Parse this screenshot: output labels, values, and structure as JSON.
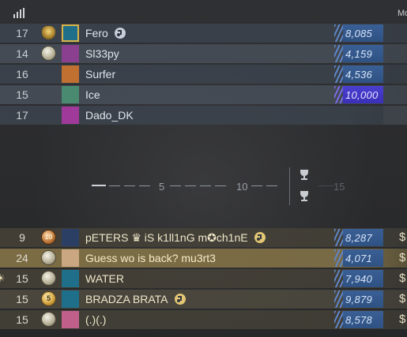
{
  "header": {
    "signal_icon": "signal-bars-icon",
    "col_label": "Mo"
  },
  "ct_players": [
    {
      "level": "17",
      "rank_icon": "crest",
      "avatar_color": "#1f6f8a",
      "avatar_frame": "gold",
      "name": "Fero",
      "music": true,
      "elo": "8,085",
      "elo_style": "blue"
    },
    {
      "level": "14",
      "rank_icon": "silver",
      "avatar_color": "#8a3f8f",
      "avatar_frame": "none",
      "name": "Sl33py",
      "music": false,
      "elo": "4,159",
      "elo_style": "blue"
    },
    {
      "level": "16",
      "rank_icon": "none",
      "avatar_color": "#c07030",
      "avatar_frame": "none",
      "name": "Surfer",
      "music": false,
      "elo": "4,536",
      "elo_style": "blue"
    },
    {
      "level": "15",
      "rank_icon": "none",
      "avatar_color": "#4a8a70",
      "avatar_frame": "none",
      "name": "Ice",
      "music": false,
      "elo": "10,000",
      "elo_style": "purple"
    },
    {
      "level": "17",
      "rank_icon": "none",
      "avatar_color": "#a03a9a",
      "avatar_frame": "none",
      "name": "Dado_DK",
      "music": false,
      "elo": "",
      "elo_style": "none"
    }
  ],
  "timeline": {
    "labels": [
      "5",
      "10",
      "15"
    ],
    "trophy_icons": [
      "trophy-icon",
      "trophy-icon"
    ]
  },
  "t_players": [
    {
      "level": "9",
      "rank_icon": "bronze",
      "rank_num": "10",
      "avatar_color": "#2a3f63",
      "name": "pETERS ♛ iS k1ll1nG m✪ch1nE",
      "music": true,
      "elo": "8,287",
      "money": "$"
    },
    {
      "level": "24",
      "rank_icon": "silver",
      "avatar_color": "#caa780",
      "name": "Guess wo is back? mu3rt3",
      "music": false,
      "elo": "4,071",
      "money": "$",
      "highlight": true
    },
    {
      "level": "15",
      "rank_icon": "silver",
      "avatar_color": "#1f6f8a",
      "name": "WATER",
      "music": false,
      "elo": "7,940",
      "money": "$",
      "edge_star": "☀"
    },
    {
      "level": "15",
      "rank_icon": "gold",
      "rank_num": "5",
      "avatar_color": "#1f6f8a",
      "name": "BRADZA BRATA",
      "music": true,
      "elo": "9,879",
      "money": "$"
    },
    {
      "level": "15",
      "rank_icon": "silver",
      "avatar_color": "#c0608a",
      "name": "(.)(.)",
      "music": false,
      "elo": "8,578",
      "money": "$"
    }
  ],
  "colors": {
    "ct_elo": "#2f5283",
    "premier_purple": "#3a2fb8",
    "t_highlight": "#807046"
  }
}
